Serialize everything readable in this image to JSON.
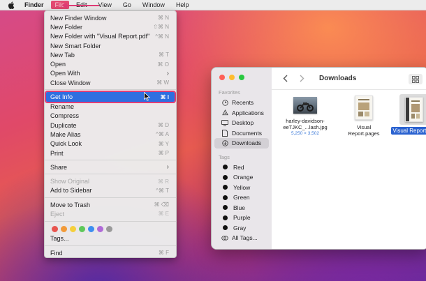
{
  "menubar": {
    "app_name": "Finder",
    "items": [
      "File",
      "Edit",
      "View",
      "Go",
      "Window",
      "Help"
    ]
  },
  "file_menu": {
    "groups": [
      [
        {
          "label": "New Finder Window",
          "shortcut": "⌘ N"
        },
        {
          "label": "New Folder",
          "shortcut": "⇧⌘ N"
        },
        {
          "label": "New Folder with \"Visual Report.pdf\"",
          "shortcut": "^⌘ N"
        },
        {
          "label": "New Smart Folder",
          "shortcut": ""
        },
        {
          "label": "New Tab",
          "shortcut": "⌘ T"
        },
        {
          "label": "Open",
          "shortcut": "⌘ O"
        },
        {
          "label": "Open With",
          "shortcut": ""
        },
        {
          "label": "Close Window",
          "shortcut": "⌘ W"
        }
      ],
      [
        {
          "label": "Get Info",
          "shortcut": "⌘ I"
        },
        {
          "label": "Rename",
          "shortcut": ""
        },
        {
          "label": "Compress",
          "shortcut": ""
        },
        {
          "label": "Duplicate",
          "shortcut": "⌘ D"
        },
        {
          "label": "Make Alias",
          "shortcut": "^⌘ A"
        },
        {
          "label": "Quick Look",
          "shortcut": "⌘ Y"
        },
        {
          "label": "Print",
          "shortcut": "⌘ P"
        }
      ],
      [
        {
          "label": "Share",
          "shortcut": ""
        }
      ],
      [
        {
          "label": "Show Original",
          "shortcut": "⌘ R"
        },
        {
          "label": "Add to Sidebar",
          "shortcut": "^⌘ T"
        }
      ],
      [
        {
          "label": "Move to Trash",
          "shortcut": "⌘ ⌫"
        },
        {
          "label": "Eject",
          "shortcut": "⌘ E"
        }
      ],
      [
        {
          "label": "Tags...",
          "shortcut": ""
        }
      ],
      [
        {
          "label": "Find",
          "shortcut": "⌘ F"
        }
      ]
    ],
    "tag_colors": [
      "#e8544e",
      "#f29a38",
      "#f5cf3b",
      "#5ec85a",
      "#3d8ef0",
      "#b06ad8",
      "#9a9a9a"
    ]
  },
  "finder_window": {
    "title": "Downloads",
    "sidebar": {
      "favorites_header": "Favorites",
      "favorites": [
        {
          "label": "Recents",
          "icon": "clock-icon"
        },
        {
          "label": "Applications",
          "icon": "applications-icon"
        },
        {
          "label": "Desktop",
          "icon": "desktop-icon"
        },
        {
          "label": "Documents",
          "icon": "document-icon"
        },
        {
          "label": "Downloads",
          "icon": "download-icon"
        }
      ],
      "tags_header": "Tags",
      "tags": [
        "Red",
        "Orange",
        "Yellow",
        "Green",
        "Blue",
        "Purple",
        "Gray"
      ],
      "all_tags": "All Tags..."
    },
    "files": [
      {
        "name_line1": "harley-davidson-",
        "name_line2": "eeTJKC_...lash.jpg",
        "dimensions": "5,250 × 3,502"
      },
      {
        "name_line1": "Visual",
        "name_line2": "Report.pages"
      },
      {
        "name_line1": "Visual Report.pdf"
      }
    ]
  },
  "colors": {
    "highlight": "#2f6fe0",
    "annotation": "#e03d76"
  }
}
